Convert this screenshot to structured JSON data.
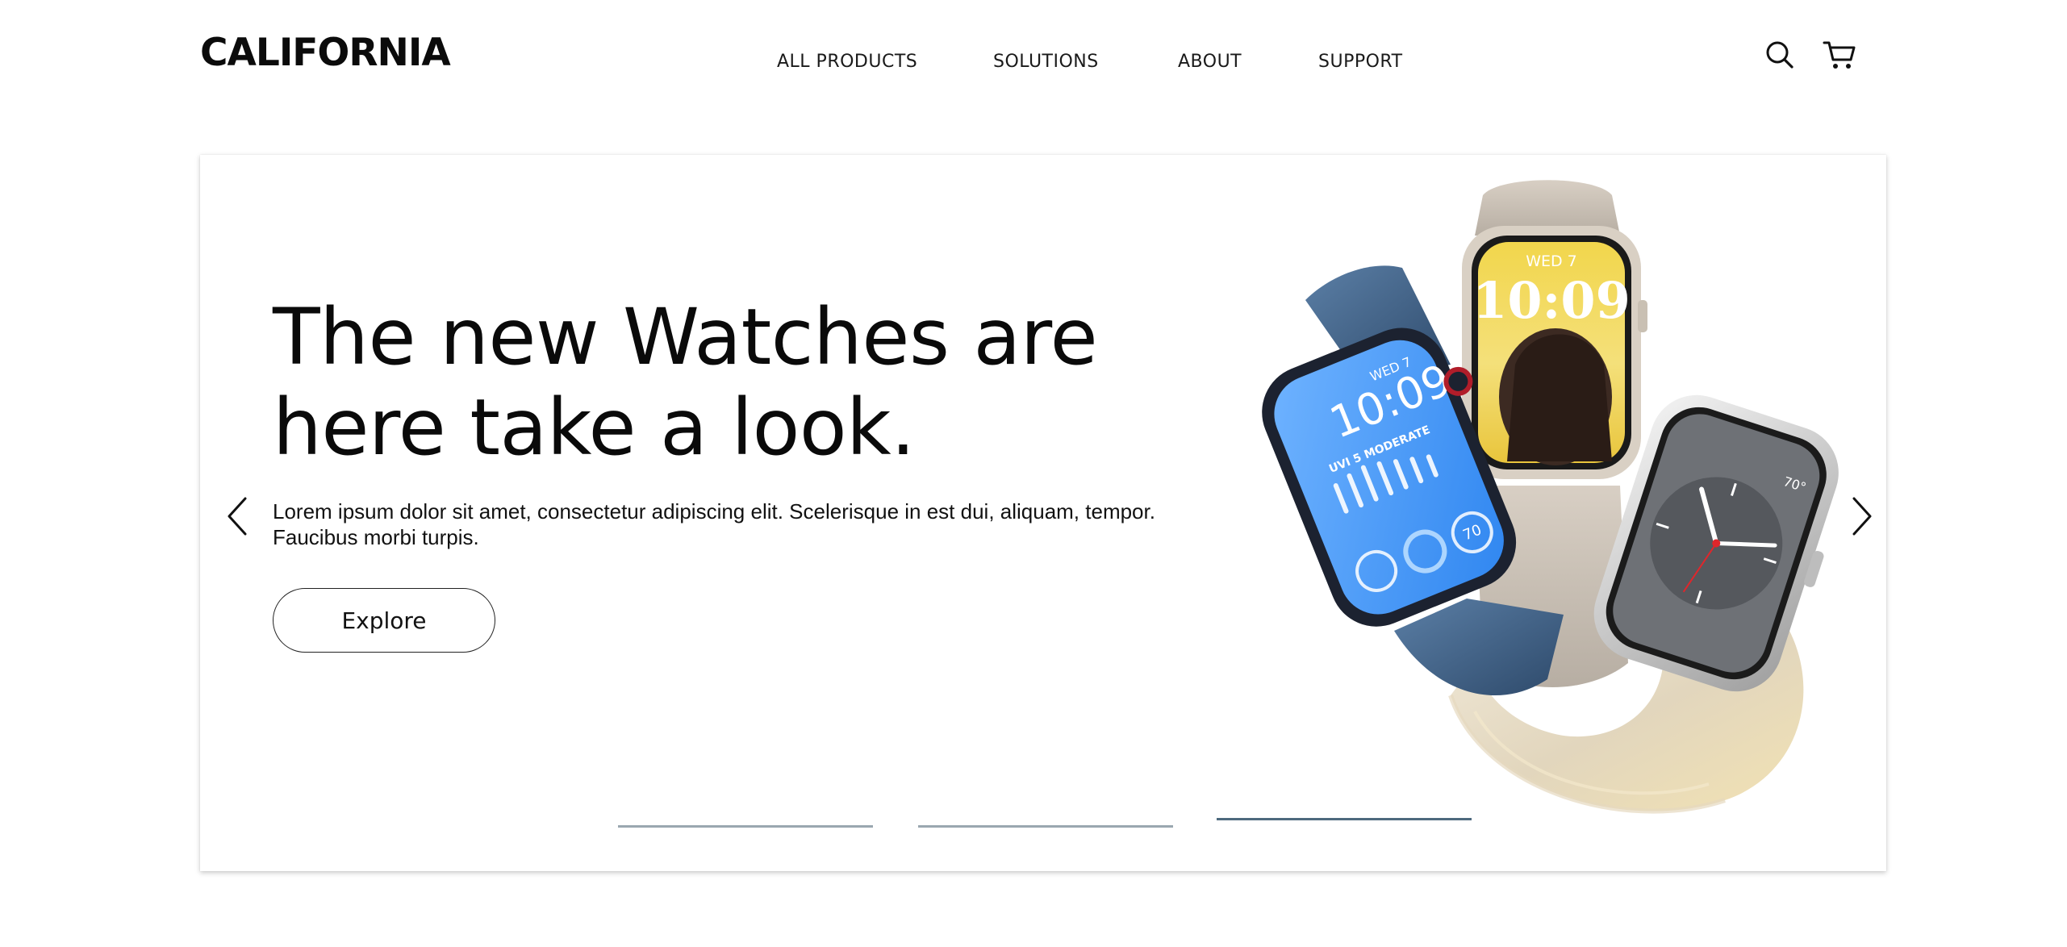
{
  "brand": {
    "logo": "CALIFORNIA"
  },
  "nav": {
    "items": [
      {
        "label": "ALL PRODUCTS"
      },
      {
        "label": "SOLUTIONS"
      },
      {
        "label": "ABOUT"
      },
      {
        "label": "SUPPORT"
      }
    ]
  },
  "header_icons": {
    "search": "search-icon",
    "cart": "cart-icon"
  },
  "hero": {
    "headline": "The new Watches are here take a look.",
    "body": "Lorem ipsum dolor sit amet, consectetur adipiscing elit. Scelerisque in est dui, aliquam, tempor. Faucibus morbi turpis.",
    "cta_label": "Explore",
    "slides": {
      "count": 3,
      "active": 3
    },
    "watch_faces": {
      "left_date": "WED 7",
      "left_time": "10:09",
      "left_uv": "UVI 5 MODERATE",
      "left_value": "70",
      "center_date": "WED 7",
      "center_time": "10:09",
      "right_temp": "70°"
    }
  },
  "colors": {
    "indicator": "#9aa7b0",
    "indicator_active": "#4e6a7e",
    "text": "#111111"
  }
}
